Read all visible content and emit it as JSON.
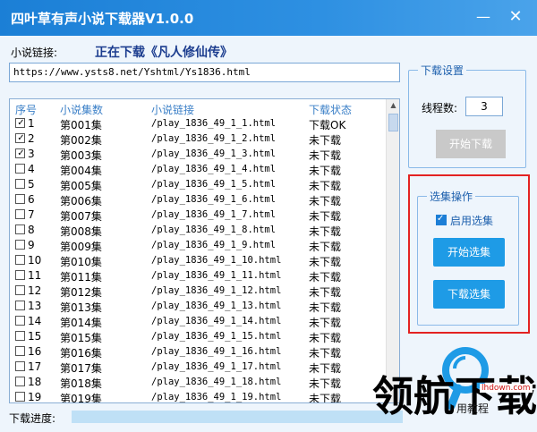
{
  "window": {
    "title": "四叶草有声小说下载器V1.0.0",
    "minimize_glyph": "—",
    "close_glyph": "✕"
  },
  "link": {
    "label": "小说链接:",
    "url": "https://www.ysts8.net/Yshtml/Ys1836.html",
    "status_prefix": "正在下载",
    "status_title": "《凡人修仙传》"
  },
  "table": {
    "headers": [
      "序号",
      "小说集数",
      "小说链接",
      "下载状态"
    ],
    "rows": [
      {
        "no": "1",
        "checked": true,
        "ep": "第001集",
        "link": "/play_1836_49_1_1.html",
        "status": "下载OK"
      },
      {
        "no": "2",
        "checked": true,
        "ep": "第002集",
        "link": "/play_1836_49_1_2.html",
        "status": "未下载"
      },
      {
        "no": "3",
        "checked": true,
        "ep": "第003集",
        "link": "/play_1836_49_1_3.html",
        "status": "未下载"
      },
      {
        "no": "4",
        "checked": false,
        "ep": "第004集",
        "link": "/play_1836_49_1_4.html",
        "status": "未下载"
      },
      {
        "no": "5",
        "checked": false,
        "ep": "第005集",
        "link": "/play_1836_49_1_5.html",
        "status": "未下载"
      },
      {
        "no": "6",
        "checked": false,
        "ep": "第006集",
        "link": "/play_1836_49_1_6.html",
        "status": "未下载"
      },
      {
        "no": "7",
        "checked": false,
        "ep": "第007集",
        "link": "/play_1836_49_1_7.html",
        "status": "未下载"
      },
      {
        "no": "8",
        "checked": false,
        "ep": "第008集",
        "link": "/play_1836_49_1_8.html",
        "status": "未下载"
      },
      {
        "no": "9",
        "checked": false,
        "ep": "第009集",
        "link": "/play_1836_49_1_9.html",
        "status": "未下载"
      },
      {
        "no": "10",
        "checked": false,
        "ep": "第010集",
        "link": "/play_1836_49_1_10.html",
        "status": "未下载"
      },
      {
        "no": "11",
        "checked": false,
        "ep": "第011集",
        "link": "/play_1836_49_1_11.html",
        "status": "未下载"
      },
      {
        "no": "12",
        "checked": false,
        "ep": "第012集",
        "link": "/play_1836_49_1_12.html",
        "status": "未下载"
      },
      {
        "no": "13",
        "checked": false,
        "ep": "第013集",
        "link": "/play_1836_49_1_13.html",
        "status": "未下载"
      },
      {
        "no": "14",
        "checked": false,
        "ep": "第014集",
        "link": "/play_1836_49_1_14.html",
        "status": "未下载"
      },
      {
        "no": "15",
        "checked": false,
        "ep": "第015集",
        "link": "/play_1836_49_1_15.html",
        "status": "未下载"
      },
      {
        "no": "16",
        "checked": false,
        "ep": "第016集",
        "link": "/play_1836_49_1_16.html",
        "status": "未下载"
      },
      {
        "no": "17",
        "checked": false,
        "ep": "第017集",
        "link": "/play_1836_49_1_17.html",
        "status": "未下载"
      },
      {
        "no": "18",
        "checked": false,
        "ep": "第018集",
        "link": "/play_1836_49_1_18.html",
        "status": "未下载"
      },
      {
        "no": "19",
        "checked": false,
        "ep": "第019集",
        "link": "/play_1836_49_1_19.html",
        "status": "未下载"
      }
    ]
  },
  "download_settings": {
    "group_title": "下载设置",
    "threads_label": "线程数:",
    "threads_value": "3",
    "start_button": "开始下载"
  },
  "selection": {
    "group_title": "选集操作",
    "enable_label": "启用选集",
    "enable_checked": true,
    "start_select_button": "开始选集",
    "download_select_button": "下载选集"
  },
  "footer": {
    "progress_label": "下载进度:",
    "progress_fraction": 0.0,
    "tutorial_link": "用教程"
  },
  "watermark": {
    "logo": "领航下载",
    "site": "lhdown.com"
  },
  "colors": {
    "accent": "#1e9be6",
    "titlebar": "#1b7fd6",
    "highlight_border": "#e32222",
    "disabled_button": "#c9c9c9"
  }
}
